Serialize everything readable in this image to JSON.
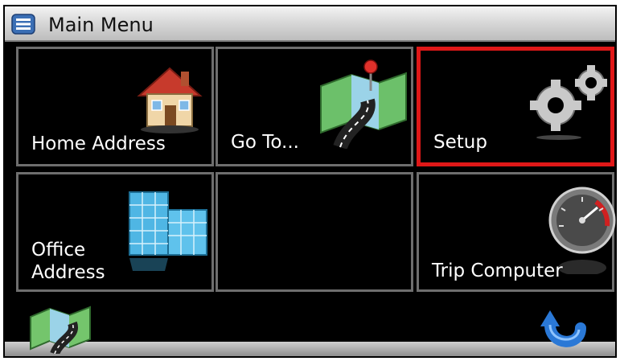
{
  "header": {
    "title": "Main Menu",
    "icon": "list-menu-icon"
  },
  "tiles": [
    {
      "label": "Home Address",
      "icon": "house-icon",
      "selected": false
    },
    {
      "label": "Go To...",
      "icon": "map-pin-route-icon",
      "selected": false
    },
    {
      "label": "Setup",
      "icon": "gears-icon",
      "selected": true
    },
    {
      "label": "Office\nAddress",
      "icon": "office-building-icon",
      "selected": false
    },
    {
      "label": "",
      "icon": "",
      "selected": false
    },
    {
      "label": "Trip Computer",
      "icon": "speedometer-icon",
      "selected": false
    }
  ],
  "footer": {
    "left_button_icon": "map-icon",
    "right_button_icon": "back-arrow-icon"
  },
  "colors": {
    "selected_border": "#e01818",
    "tile_border": "#6e6e6e",
    "background": "#000000"
  }
}
